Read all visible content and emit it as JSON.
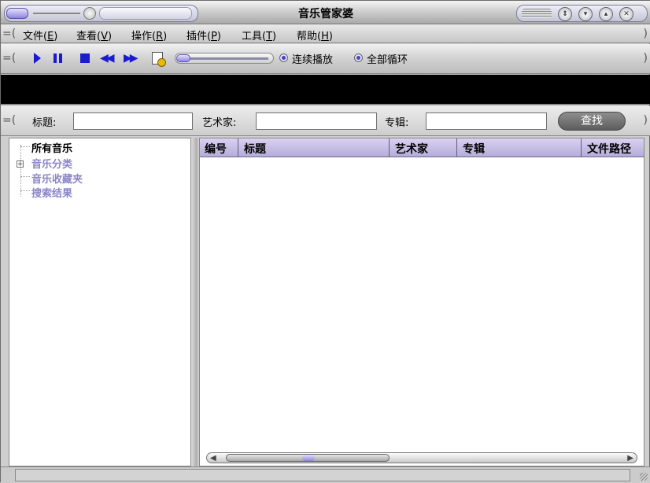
{
  "window": {
    "title": "音乐管家婆"
  },
  "window_controls": [
    {
      "name": "scroll-arrows",
      "glyph": "⇕"
    },
    {
      "name": "minimize",
      "glyph": "▾"
    },
    {
      "name": "maximize",
      "glyph": "▴"
    },
    {
      "name": "close",
      "glyph": "✕"
    }
  ],
  "menu": [
    {
      "label": "文件(",
      "key": "E",
      "after": ")"
    },
    {
      "label": "查看(",
      "key": "V",
      "after": ")"
    },
    {
      "label": "操作(",
      "key": "R",
      "after": ")"
    },
    {
      "label": "插件(",
      "key": "P",
      "after": ")"
    },
    {
      "label": "工具(",
      "key": "T",
      "after": ")"
    },
    {
      "label": "帮助(",
      "key": "H",
      "after": ")"
    }
  ],
  "toolbar": {
    "buttons": [
      "play-icon",
      "pause-icon",
      "stop-icon",
      "previous-icon",
      "next-icon",
      "edit-document-icon"
    ],
    "prev_glyph": "◀◀",
    "next_glyph": "▶▶",
    "options": [
      {
        "label": "连续播放",
        "checked": true
      },
      {
        "label": "全部循环",
        "checked": true
      }
    ],
    "volume_level": 0.0
  },
  "search": {
    "title_label": "标题:",
    "artist_label": "艺术家:",
    "album_label": "专辑:",
    "title_value": "",
    "artist_value": "",
    "album_value": "",
    "button": "查找"
  },
  "tree": {
    "items": [
      {
        "label": "所有音乐",
        "selected": true
      },
      {
        "label": "音乐分类",
        "selected": false,
        "expandable": true,
        "expander": "+"
      },
      {
        "label": "音乐收藏夹",
        "selected": false
      },
      {
        "label": "搜索结果",
        "selected": false
      }
    ]
  },
  "list": {
    "columns": [
      "编号",
      "标题",
      "艺术家",
      "专辑",
      "文件路径"
    ],
    "rows": []
  },
  "status": {
    "text": ""
  },
  "colors": {
    "header_bg": "#c4bce4",
    "tree_item": "#8a85c9",
    "accent": "#1a1ad0",
    "display_bg": "#000000"
  }
}
